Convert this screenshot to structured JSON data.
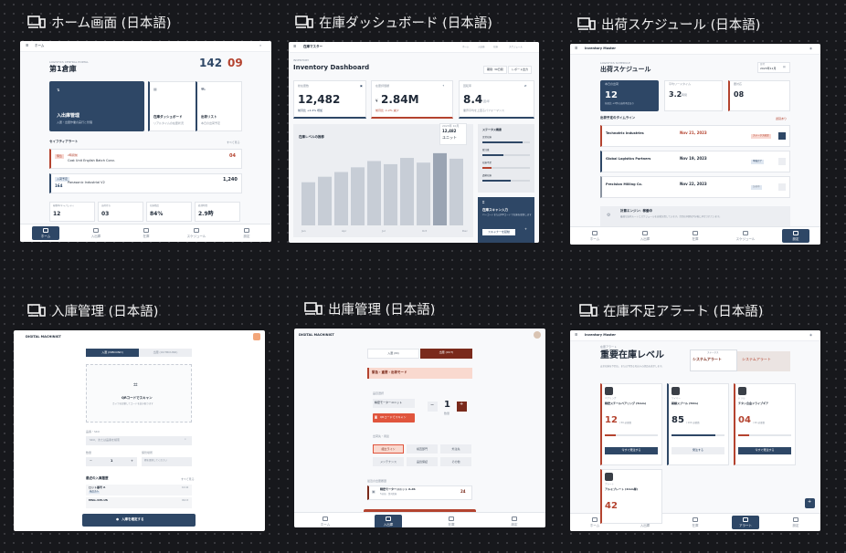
{
  "panels": [
    {
      "title": "ホーム画面 (日本語)"
    },
    {
      "title": "在庫ダッシュボード (日本語)"
    },
    {
      "title": "出荷スケジュール (日本語)"
    },
    {
      "title": "入庫管理 (日本語)"
    },
    {
      "title": "出庫管理 (日本語)"
    },
    {
      "title": "在庫不足アラート (日本語)"
    }
  ],
  "home": {
    "header_title": "ホーム",
    "kicker": "LOGISTICS CENTRAL PORTAL",
    "warehouse": "第1倉庫",
    "stat1": "142",
    "stat2": "09",
    "inbound_title": "入出庫管理",
    "inbound_sub": "入庫・出庫作業の実行と管理",
    "dash_title": "在庫ダッシュボード",
    "dash_sub": "リアルタイムの在庫状況",
    "ship_title": "出荷リスト",
    "ship_sub": "本日の出荷予定",
    "alerts_heading": "セイフティアラート",
    "alerts_link": "すべて見る",
    "alert1_badge": "緊急",
    "alert1_code": "2時間前",
    "alert1_text": "Cost Unit English Batch Conv.",
    "alert1_num": "04",
    "alert2_badge": "入荷予定",
    "alert2_num_box": "164",
    "alert2_text": "Panasonic Industrial V2",
    "alert2_num": "1,240",
    "kpis": [
      {
        "label": "稼働率/キャパシティ",
        "value": "12"
      },
      {
        "label": "出荷待ち",
        "value": "03"
      },
      {
        "label": "在庫精度",
        "value": "84%"
      },
      {
        "label": "処理時間",
        "value": "2.9時"
      }
    ],
    "nav": [
      "ホーム",
      "入出庫",
      "在庫",
      "スケジュール",
      "設定"
    ]
  },
  "dash": {
    "app": "在庫マスター",
    "menu": [
      "ホーム",
      "入出庫",
      "在庫",
      "スケジュール"
    ],
    "kicker": "INVENTORY",
    "title": "Inventory Dashboard",
    "btn1": "期間: 30日間",
    "btn2": "レポート出力",
    "k1_label": "総在庫数",
    "k1_value": "12,482",
    "k1_sub": "前月比 +2.4% 増加",
    "k2_label": "在庫評価額",
    "k2_value": "2.84M",
    "k2_sub": "前月比 -1.2% 減少",
    "k3_label": "回転率",
    "k3_value": "8.4",
    "k3_unit": "回/年",
    "k3_sub": "業界平均を上回るパフォーマンス",
    "chart_title": "在庫レベルの推移",
    "tooltip_label": "2023年 10月",
    "tooltip_value": "12,482",
    "tooltip_unit": "ユニット",
    "months": [
      "Jan",
      "Apr",
      "Jul",
      "Oct",
      "Dec"
    ],
    "status_title": "ステータス概要",
    "status_rows": [
      "正常在庫",
      "要注意",
      "在庫不足",
      "過剰在庫"
    ],
    "scan_title": "在庫スキャン入力",
    "scan_sub": "バーコードまたはQRコードで在庫を更新します",
    "scan_btn": "スキャナーを起動"
  },
  "sched": {
    "app": "Inventory Master",
    "kicker": "LOGISTICS SCHEDULE",
    "title": "出荷スケジュール",
    "date_label": "日付",
    "date": "2023年11月",
    "k1": "12",
    "k1_label": "本日の出荷",
    "k1_sub": "前日比 +2件の出荷予定あり",
    "k2": "3.2",
    "k2_unit": "時間",
    "k2_label": "平均リードタイム",
    "k3": "08",
    "k3_label": "要対応",
    "list_title": "出荷予定のタイムライン",
    "list_badge": "遅延あり",
    "rows": [
      {
        "name": "Technotrix Industries",
        "date": "Nov 21, 2023",
        "status": "ステータス確認"
      },
      {
        "name": "Global Logistics Partners",
        "date": "Nov 19, 2023",
        "status": "準備完了"
      },
      {
        "name": "Precision Milling Co.",
        "date": "Nov 22, 2023",
        "status": "計画中"
      }
    ],
    "engine_title": "計算エンジン：稼働中",
    "engine_text": "最適な出荷ルートとスケジュールを自動計算しています。次回の同期は5分後に予定されています。",
    "nav": [
      "ホーム",
      "入出庫",
      "在庫",
      "スケジュール",
      "設定"
    ]
  },
  "inbound": {
    "brand": "DIGITAL MACHINIST",
    "tab1": "入庫 (INBOUND)",
    "tab2": "出庫 (OUTBOUND)",
    "scan_title": "QRコードでスキャン",
    "scan_sub": "カメラを起動してコードを読み取ります",
    "search_label": "品番・SKU",
    "search_placeholder": "SKU、または品番を検索",
    "qty_label": "数量",
    "qty": "1",
    "loc_label": "保管場所",
    "loc": "棚を選択してください",
    "hist_title": "最近の入庫履歴",
    "hist_link": "すべて見る",
    "hist": [
      {
        "name": "ロット番号 A",
        "badge": "検品済み",
        "time": "10:42"
      },
      {
        "name": "MSG-445-US",
        "badge": "",
        "time": "09:15"
      }
    ],
    "confirm": "入庫を確定する"
  },
  "outbound": {
    "brand": "DIGITAL MACHINIST",
    "tab1": "入庫 (IN)",
    "tab2": "出庫 (OUT)",
    "alert": "緊急・重要・出荷モード",
    "item_label": "品目選択",
    "item": "精密モーターユニット",
    "qty": "1",
    "qty_label": "数量",
    "scan_btn": "QRコードでスキャン",
    "dest_label": "出荷先・用途",
    "chips": [
      "組立ライン",
      "検査部門",
      "外注先",
      "メンテナンス",
      "品質保証",
      "その他"
    ],
    "recent_label": "最近の出庫履歴",
    "recent_item": "精密モーターユニット A-01",
    "recent_sub": "5分前 · 第1倉庫",
    "recent_qty": "24",
    "nav": [
      "ホーム",
      "入出庫",
      "在庫",
      "設定"
    ]
  },
  "alert": {
    "app": "Inventory Master",
    "kicker": "在庫アラート",
    "title": "重要在庫レベル",
    "desc": "安全在庫を下回る、または下回る見込みの部品を表示します。",
    "sys1_label": "ステータス",
    "sys1": "システムアラート",
    "sys2": "システムアラート",
    "items": [
      {
        "cat": "ベアリング",
        "name": "精密スチールベアリング (5mm)",
        "qty": "12",
        "unit": "/ 50 必要数",
        "btn": "今すぐ発注する"
      },
      {
        "cat": "ワイヤー",
        "name": "銅線スプール (50m)",
        "qty": "85",
        "unit": "/ 100 必要数",
        "btn": "発注する"
      },
      {
        "cat": "ドリル",
        "name": "チタン合金ドライブギア",
        "qty": "04",
        "unit": "/ 20 必要数",
        "btn": "今すぐ発注する"
      },
      {
        "cat": "プレート",
        "name": "アルミプレート (2mm厚)",
        "qty": "42",
        "unit": "",
        "btn": ""
      }
    ],
    "nav": [
      "ホーム",
      "入出庫",
      "在庫",
      "アラート",
      "設定"
    ]
  }
}
